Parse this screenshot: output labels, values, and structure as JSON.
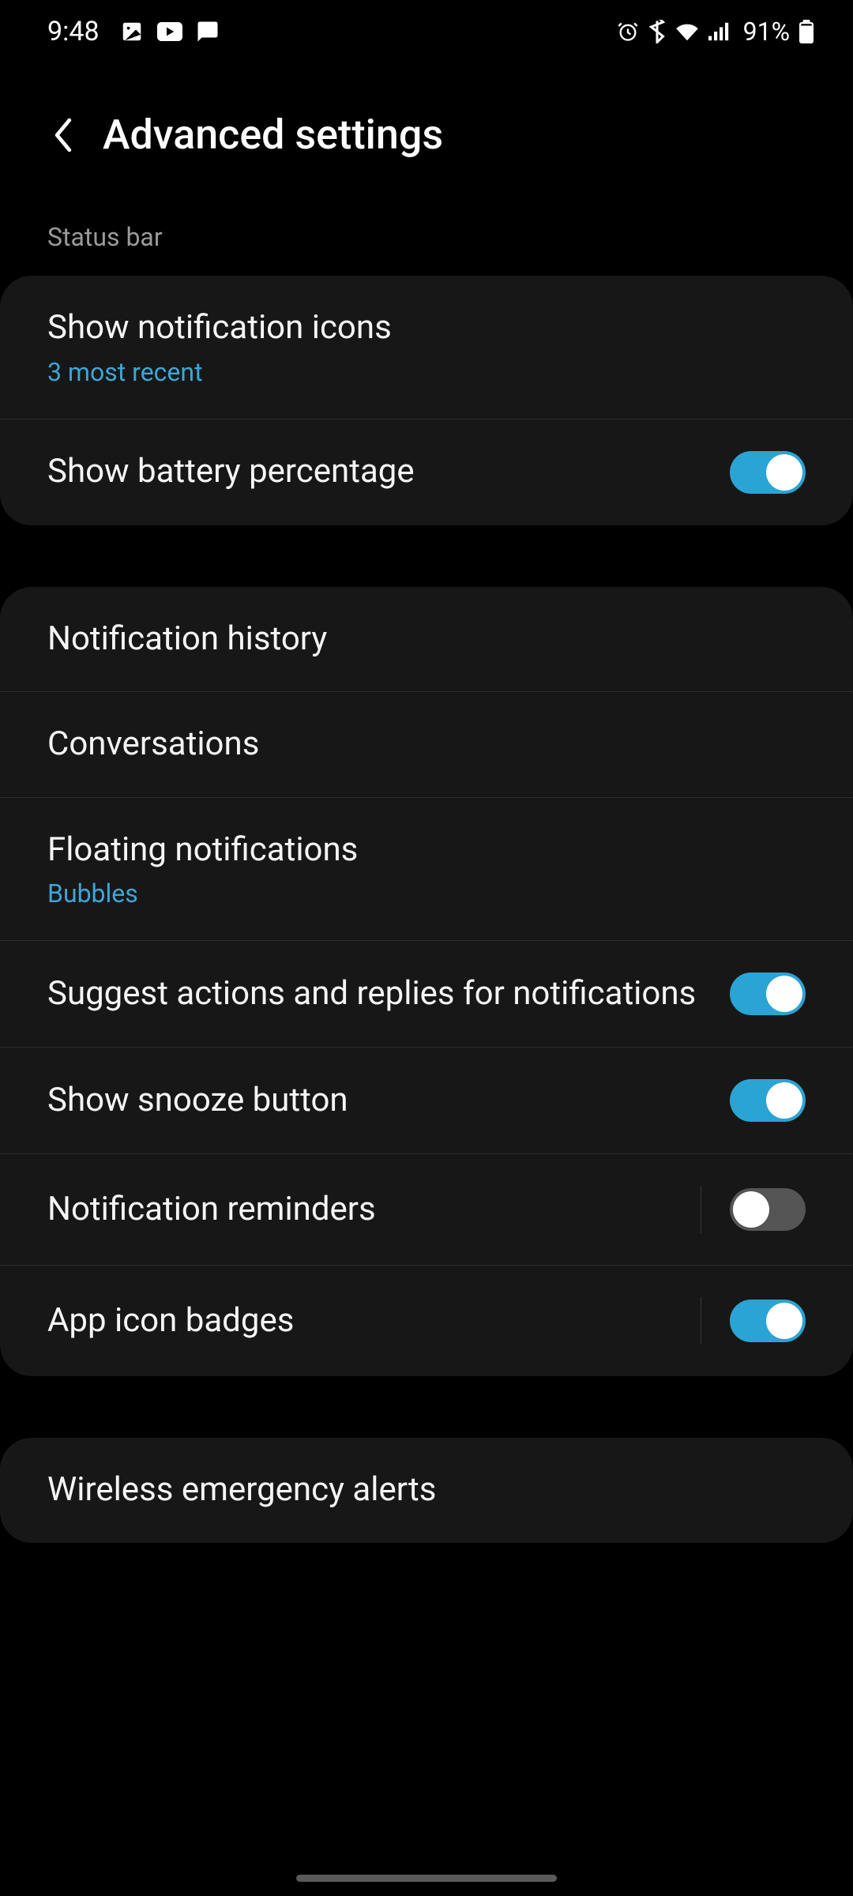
{
  "status": {
    "time": "9:48",
    "battery_text": "91%"
  },
  "header": {
    "title": "Advanced settings"
  },
  "section1": {
    "label": "Status bar",
    "items": [
      {
        "title": "Show notification icons",
        "subtitle": "3 most recent",
        "toggle": null
      },
      {
        "title": "Show battery percentage",
        "subtitle": null,
        "toggle": true
      }
    ]
  },
  "section2": {
    "items": [
      {
        "title": "Notification history",
        "subtitle": null,
        "toggle": null
      },
      {
        "title": "Conversations",
        "subtitle": null,
        "toggle": null
      },
      {
        "title": "Floating notifications",
        "subtitle": "Bubbles",
        "toggle": null
      },
      {
        "title": "Suggest actions and replies for notifications",
        "subtitle": null,
        "toggle": true
      },
      {
        "title": "Show snooze button",
        "subtitle": null,
        "toggle": true
      },
      {
        "title": "Notification reminders",
        "subtitle": null,
        "toggle": false,
        "split": true
      },
      {
        "title": "App icon badges",
        "subtitle": null,
        "toggle": true,
        "split": true
      }
    ]
  },
  "section3": {
    "items": [
      {
        "title": "Wireless emergency alerts",
        "subtitle": null,
        "toggle": null
      }
    ]
  },
  "colors": {
    "accent": "#2aa4d4",
    "subtitle_accent": "#3ba7d6",
    "card_bg": "#171717"
  }
}
